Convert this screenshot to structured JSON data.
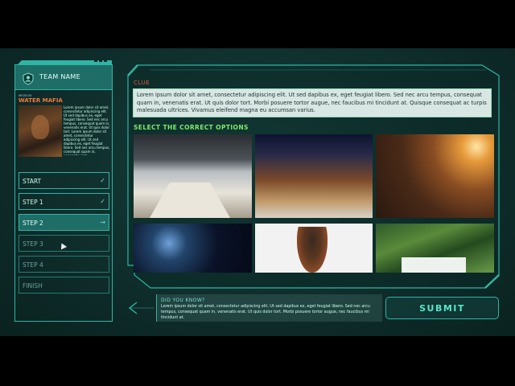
{
  "team": {
    "name": "TEAM NAME"
  },
  "mission": {
    "label": "MISSION",
    "name": "WATER MAFIA",
    "text": "Lorem ipsum dolor sit amet, consectetur adipiscing elit. Ut sed dapibus ex, eget feugiat libero. Sed nec arcu tempus, consequat quam in, venenatis erat. Ut quis dolor tort. Lorem ipsum dolor sit amet, consectetur adipiscing elit. Ut sed dapibus ex, eget feugiat libero. Sed nec arcu tempus, consequat quam in, venenatis erat."
  },
  "steps": [
    {
      "label": "START",
      "icon": "check-icon"
    },
    {
      "label": "STEP 1",
      "icon": "check-icon"
    },
    {
      "label": "STEP 2",
      "icon": "arrow-right-icon"
    },
    {
      "label": "STEP 3",
      "icon": ""
    },
    {
      "label": "STEP 4",
      "icon": ""
    },
    {
      "label": "FINISH",
      "icon": ""
    }
  ],
  "clue": {
    "label": "CLUE",
    "text": "Lorem ipsum dolor sit amet, consectetur adipiscing elit. Ut sed dapibus ex, eget feugiat libero. Sed nec arcu tempus, consequat quam in, venenatis erat. Ut quis dolor tort. Morbi posuere tortor augue, nec faucibus mi tincidunt at. Quisque consequat ac turpis malesuada ultrices. Vivamus eleifend magna eu accumsan varius."
  },
  "options": {
    "label": "SELECT THE CORRECT OPTIONS",
    "images": [
      "office-interior",
      "gingerbread-village",
      "desert-sunset",
      "space-station",
      "chimpanzee-praying",
      "jungle-foliage"
    ]
  },
  "did_you_know": {
    "label": "DID YOU KNOW?",
    "text": "Lorem ipsum dolor sit amet, consectetur adipiscing elit. Ut sed dapibus ex, eget feugiat libero. Sed nec arcu tempus, consequat quam in, venenatis erat. Ut quis dolor tort. Morbi posuere tortor augue, nec faucibus mi tincidunt at."
  },
  "submit_label": "SUBMIT",
  "colors": {
    "accent": "#2fb5a5",
    "clue": "#e4573b",
    "select": "#7fe96a",
    "mission": "#f07a3c"
  }
}
